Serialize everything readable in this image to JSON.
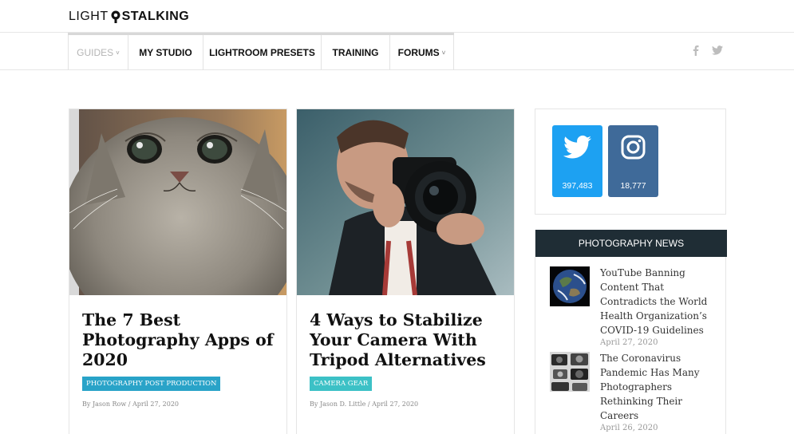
{
  "brand": {
    "light": "LIGHT",
    "stalking": "STALKING"
  },
  "nav": {
    "items": [
      {
        "label": "GUIDES",
        "has_caret": true,
        "muted": true
      },
      {
        "label": "MY STUDIO",
        "has_caret": false,
        "muted": false
      },
      {
        "label": "LIGHTROOM PRESETS",
        "has_caret": false,
        "muted": false
      },
      {
        "label": "TRAINING",
        "has_caret": false,
        "muted": false
      },
      {
        "label": "FORUMS",
        "has_caret": true,
        "muted": false
      }
    ],
    "caret": "˅",
    "social_icons": [
      "facebook-icon",
      "twitter-icon"
    ]
  },
  "articles": [
    {
      "image": "kitten-photo",
      "title": "The 7 Best Photography Apps of 2020",
      "category": "PHOTOGRAPHY POST PRODUCTION",
      "category_color": "#29a3c8",
      "byline": "By Jason Row / April 27, 2020"
    },
    {
      "image": "photographer-with-camera-photo",
      "title": "4 Ways to Stabilize Your Camera With Tripod Alternatives",
      "category": "CAMERA GEAR",
      "category_color": "#3cc1c6",
      "byline": "By Jason D. Little / April 27, 2020"
    }
  ],
  "follow": {
    "twitter": {
      "count": "397,483",
      "color": "#1da1f2",
      "icon": "twitter-icon"
    },
    "instagram": {
      "count": "18,777",
      "color": "#3f6a99",
      "icon": "instagram-icon"
    }
  },
  "news": {
    "header": "PHOTOGRAPHY NEWS",
    "header_color": "#1f2d35",
    "items": [
      {
        "thumb": "earth-thumbnail",
        "title": "YouTube Banning Content That Contradicts the World Health Organization’s COVID-19 Guidelines",
        "date": "April 27, 2020"
      },
      {
        "thumb": "cameras-thumbnail",
        "title": "The Coronavirus Pandemic Has Many Photographers Rethinking Their Careers",
        "date": "April 26, 2020"
      }
    ]
  }
}
